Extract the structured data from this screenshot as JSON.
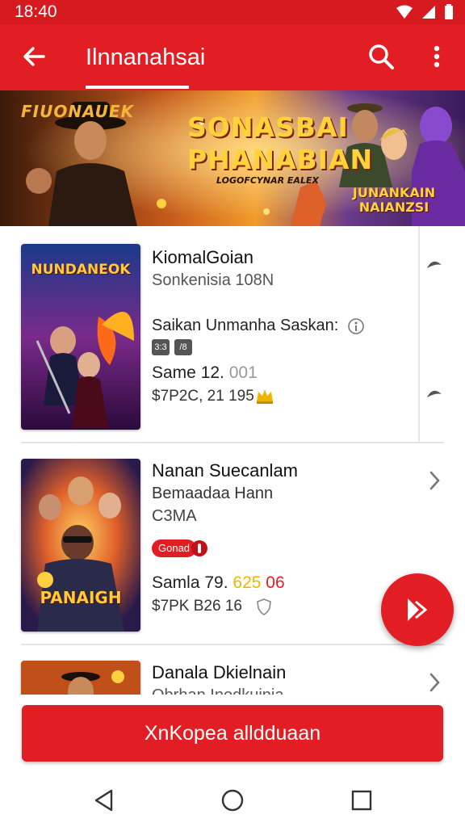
{
  "status_bar": {
    "time": "18:40",
    "icons": [
      "wifi-icon",
      "signal-icon",
      "battery-icon"
    ]
  },
  "app_bar": {
    "title": "Ilnnanahsai",
    "back_icon": "arrow-back-icon",
    "search_icon": "search-icon",
    "more_icon": "more-vert-icon"
  },
  "banner": {
    "top_left_text": "FIUONAUEK",
    "headline_1": "SONASBAI",
    "headline_2": "PHANABIAN",
    "tagline": "LOGOFCYNAR EALEX",
    "corner_text": "JUNANKAIN NAIANZSI"
  },
  "items": [
    {
      "title": "KiomalGoian",
      "subtitle": "Sonkenisia 108N",
      "cover_text": "NUNDANEOK",
      "line3": "Saikan Unmanha Saskan:",
      "tags": [
        "3:3",
        "/8"
      ],
      "line4": "Same 12.",
      "line4_extra": "001",
      "price": "$7P2C, 21 195"
    },
    {
      "title": "Nanan Suecanlam",
      "subtitle": "Bemaadaa Hann",
      "line3": "C3MA",
      "cover_text": "PANAIGH",
      "pill": "Gonad",
      "line4": "Samla 79.",
      "line4_extra_1": "625",
      "line4_extra_2": "06",
      "price": "$7PK B26 16"
    },
    {
      "title": "Danala Dkielnain",
      "subtitle": "Obrhan Inodkuinia..."
    }
  ],
  "action_button": {
    "label": "XnKopea alldduaan"
  },
  "colors": {
    "brand_red": "#e21d24",
    "accent_gold": "#f0b400"
  },
  "nav_bar": {
    "icons": [
      "back-triangle-icon",
      "home-circle-icon",
      "recents-square-icon"
    ]
  }
}
